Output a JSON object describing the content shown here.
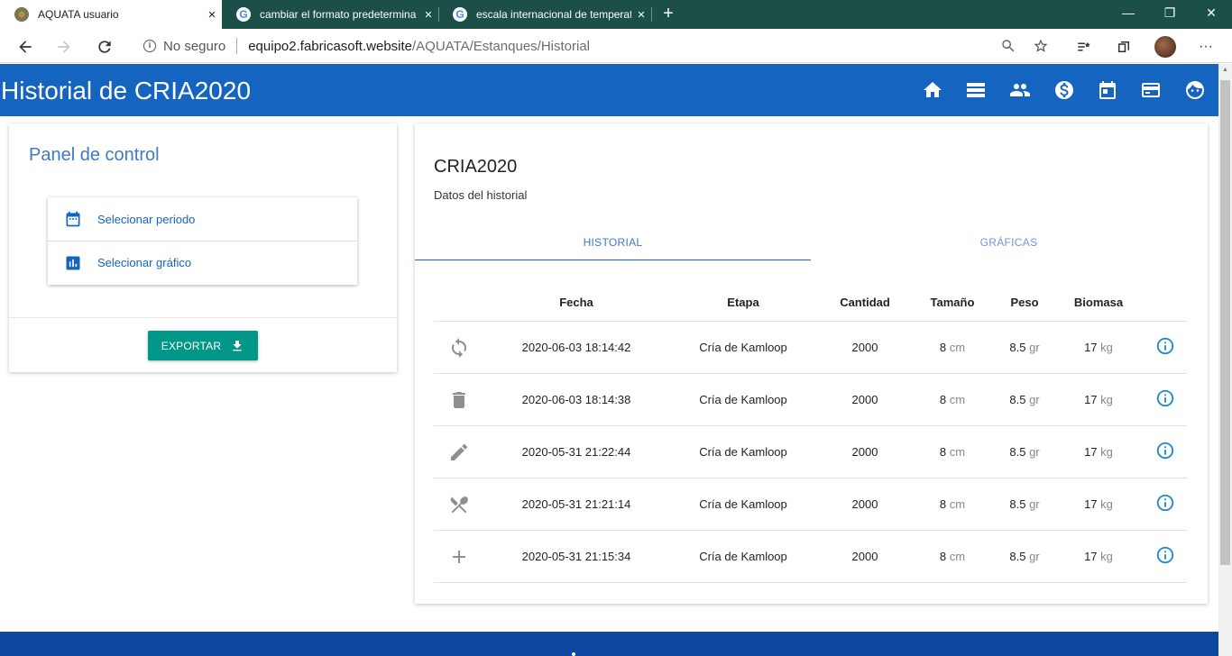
{
  "browser": {
    "tabs": [
      {
        "title": "AQUATA usuario",
        "active": true
      },
      {
        "title": "cambiar el formato predetermina",
        "active": false
      },
      {
        "title": "escala internacional de temperat",
        "active": false
      }
    ],
    "tab_close_glyph": "×",
    "new_tab_glyph": "+",
    "window_controls": [
      "—",
      "❐",
      "✕"
    ],
    "security_label": "No seguro",
    "url_host": "equipo2.fabricasoft.website",
    "url_path": "/AQUATA/Estanques/Historial"
  },
  "appbar": {
    "title": "Historial de CRIA2020",
    "icons": [
      "home-icon",
      "list-icon",
      "people-icon",
      "money-icon",
      "calendar-icon",
      "card-icon",
      "face-icon"
    ]
  },
  "panel": {
    "title": "Panel de control",
    "menu": [
      {
        "label": "Selecionar periodo",
        "icon": "calendar-icon"
      },
      {
        "label": "Selecionar gráfico",
        "icon": "bar-chart-icon"
      }
    ],
    "export_label": "EXPORTAR"
  },
  "card": {
    "title": "CRIA2020",
    "subtitle": "Datos del historial",
    "tabs": [
      "HISTORIAL",
      "GRÁFICAS"
    ],
    "active_tab": "HISTORIAL"
  },
  "table": {
    "headers": [
      "Fecha",
      "Etapa",
      "Cantidad",
      "Tamaño",
      "Peso",
      "Biomasa"
    ],
    "rows": [
      {
        "icon": "sync-icon",
        "fecha": "2020-06-03 18:14:42",
        "etapa": "Cría de Kamloop",
        "cantidad": "2000",
        "tamano": "8",
        "tamano_unit": "cm",
        "peso": "8.5",
        "peso_unit": "gr",
        "biomasa": "17",
        "biomasa_unit": "kg"
      },
      {
        "icon": "trash-icon",
        "fecha": "2020-06-03 18:14:38",
        "etapa": "Cría de Kamloop",
        "cantidad": "2000",
        "tamano": "8",
        "tamano_unit": "cm",
        "peso": "8.5",
        "peso_unit": "gr",
        "biomasa": "17",
        "biomasa_unit": "kg"
      },
      {
        "icon": "pencil-icon",
        "fecha": "2020-05-31 21:22:44",
        "etapa": "Cría de Kamloop",
        "cantidad": "2000",
        "tamano": "8",
        "tamano_unit": "cm",
        "peso": "8.5",
        "peso_unit": "gr",
        "biomasa": "17",
        "biomasa_unit": "kg"
      },
      {
        "icon": "utensils-icon",
        "fecha": "2020-05-31 21:21:14",
        "etapa": "Cría de Kamloop",
        "cantidad": "2000",
        "tamano": "8",
        "tamano_unit": "cm",
        "peso": "8.5",
        "peso_unit": "gr",
        "biomasa": "17",
        "biomasa_unit": "kg"
      },
      {
        "icon": "plus-icon",
        "fecha": "2020-05-31 21:15:34",
        "etapa": "Cría de Kamloop",
        "cantidad": "2000",
        "tamano": "8",
        "tamano_unit": "cm",
        "peso": "8.5",
        "peso_unit": "gr",
        "biomasa": "17",
        "biomasa_unit": "kg"
      }
    ]
  },
  "colors": {
    "appbar": "#1565c0",
    "accent_teal": "#009688",
    "footer": "#0d47a1",
    "tabbar": "#1b4f48"
  }
}
